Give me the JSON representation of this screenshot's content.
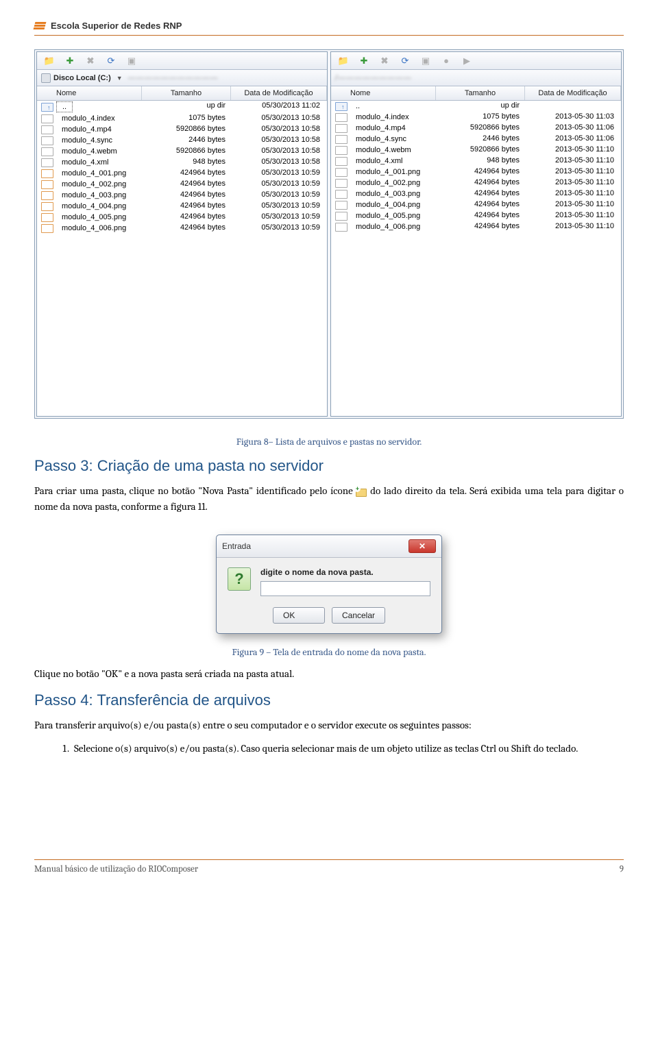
{
  "header": {
    "brand": "Escola Superior de Redes RNP"
  },
  "ftp": {
    "columns": {
      "name": "Nome",
      "size": "Tamanho",
      "date": "Data de Modificação"
    },
    "left": {
      "path": "Disco Local (C:)",
      "rows": [
        {
          "icon": "up",
          "name": "..",
          "size": "up dir",
          "date": "05/30/2013 11:02"
        },
        {
          "icon": "file",
          "name": "modulo_4.index",
          "size": "1075 bytes",
          "date": "05/30/2013 10:58"
        },
        {
          "icon": "file",
          "name": "modulo_4.mp4",
          "size": "5920866 bytes",
          "date": "05/30/2013 10:58"
        },
        {
          "icon": "file",
          "name": "modulo_4.sync",
          "size": "2446 bytes",
          "date": "05/30/2013 10:58"
        },
        {
          "icon": "file",
          "name": "modulo_4.webm",
          "size": "5920866 bytes",
          "date": "05/30/2013 10:58"
        },
        {
          "icon": "file",
          "name": "modulo_4.xml",
          "size": "948 bytes",
          "date": "05/30/2013 10:58"
        },
        {
          "icon": "img",
          "name": "modulo_4_001.png",
          "size": "424964 bytes",
          "date": "05/30/2013 10:59"
        },
        {
          "icon": "img",
          "name": "modulo_4_002.png",
          "size": "424964 bytes",
          "date": "05/30/2013 10:59"
        },
        {
          "icon": "img",
          "name": "modulo_4_003.png",
          "size": "424964 bytes",
          "date": "05/30/2013 10:59"
        },
        {
          "icon": "img",
          "name": "modulo_4_004.png",
          "size": "424964 bytes",
          "date": "05/30/2013 10:59"
        },
        {
          "icon": "img",
          "name": "modulo_4_005.png",
          "size": "424964 bytes",
          "date": "05/30/2013 10:59"
        },
        {
          "icon": "img",
          "name": "modulo_4_006.png",
          "size": "424964 bytes",
          "date": "05/30/2013 10:59"
        }
      ]
    },
    "right": {
      "rows": [
        {
          "icon": "up",
          "name": "..",
          "size": "up dir",
          "date": ""
        },
        {
          "icon": "file",
          "name": "modulo_4.index",
          "size": "1075 bytes",
          "date": "2013-05-30 11:03"
        },
        {
          "icon": "file",
          "name": "modulo_4.mp4",
          "size": "5920866 bytes",
          "date": "2013-05-30 11:06"
        },
        {
          "icon": "file",
          "name": "modulo_4.sync",
          "size": "2446 bytes",
          "date": "2013-05-30 11:06"
        },
        {
          "icon": "file",
          "name": "modulo_4.webm",
          "size": "5920866 bytes",
          "date": "2013-05-30 11:10"
        },
        {
          "icon": "file",
          "name": "modulo_4.xml",
          "size": "948 bytes",
          "date": "2013-05-30 11:10"
        },
        {
          "icon": "file",
          "name": "modulo_4_001.png",
          "size": "424964 bytes",
          "date": "2013-05-30 11:10"
        },
        {
          "icon": "file",
          "name": "modulo_4_002.png",
          "size": "424964 bytes",
          "date": "2013-05-30 11:10"
        },
        {
          "icon": "file",
          "name": "modulo_4_003.png",
          "size": "424964 bytes",
          "date": "2013-05-30 11:10"
        },
        {
          "icon": "file",
          "name": "modulo_4_004.png",
          "size": "424964 bytes",
          "date": "2013-05-30 11:10"
        },
        {
          "icon": "file",
          "name": "modulo_4_005.png",
          "size": "424964 bytes",
          "date": "2013-05-30 11:10"
        },
        {
          "icon": "file",
          "name": "modulo_4_006.png",
          "size": "424964 bytes",
          "date": "2013-05-30 11:10"
        }
      ]
    }
  },
  "captions": {
    "fig8": "Figura 8– Lista de arquivos e pastas no servidor.",
    "fig9": "Figura 9 – Tela de entrada do nome da nova pasta."
  },
  "steps": {
    "s3_title": "Passo 3: Criação de uma pasta no servidor",
    "s3_p_a": "Para criar uma pasta, clique no botão \"Nova Pasta\" identificado pelo ícone ",
    "s3_p_b": " do lado direito da tela. Será exibida uma tela para digitar o nome da nova pasta, conforme a figura 11.",
    "s3_after": "Clique no botão \"OK\" e a nova pasta será criada na pasta atual.",
    "s4_title": "Passo 4: Transferência de arquivos",
    "s4_p": "Para transferir arquivo(s) e/ou pasta(s) entre o seu computador e o servidor execute os seguintes passos:",
    "s4_li1": "Selecione o(s) arquivo(s) e/ou pasta(s). Caso queria selecionar mais de um objeto utilize as teclas Ctrl ou Shift do teclado."
  },
  "dialog": {
    "title": "Entrada",
    "msg": "digite o nome da nova pasta.",
    "ok": "OK",
    "cancel": "Cancelar"
  },
  "footer": {
    "left": "Manual básico de utilização do RIOComposer",
    "right": "9"
  }
}
